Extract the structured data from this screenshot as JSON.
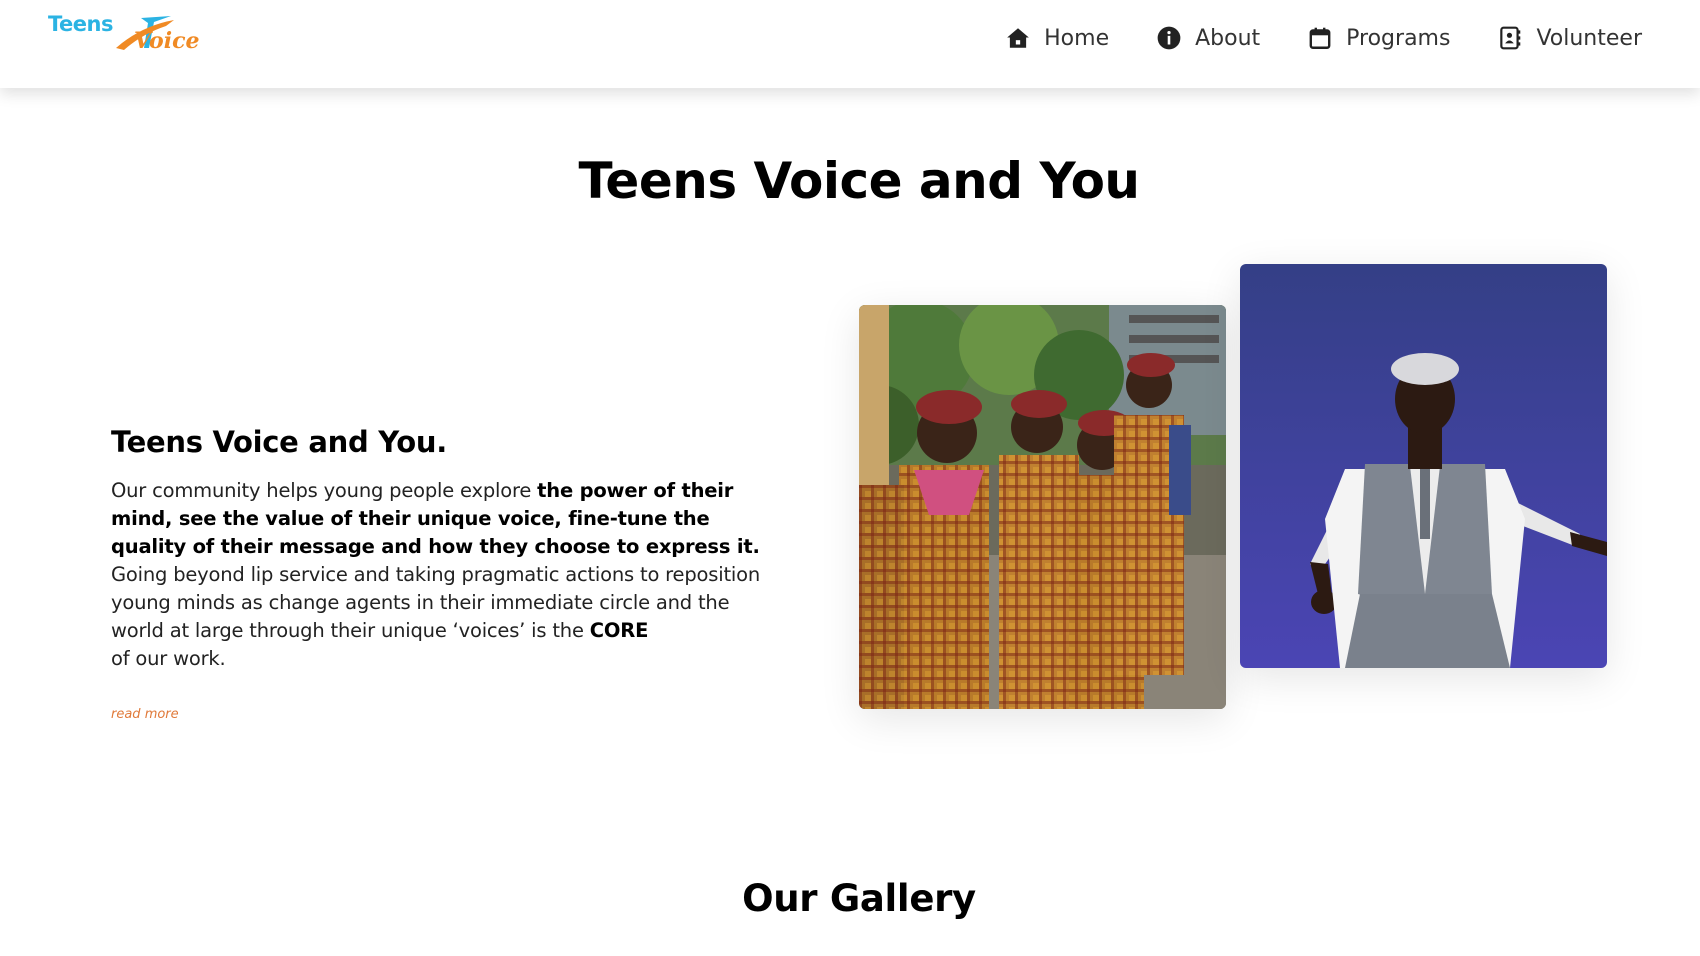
{
  "brand": {
    "logo_text_top": "Teens",
    "logo_text_bottom": "Voice",
    "colors": {
      "blue": "#2bb3e3",
      "orange": "#f08a24"
    }
  },
  "nav": {
    "items": [
      {
        "label": "Home",
        "icon": "home-icon"
      },
      {
        "label": "About",
        "icon": "info-icon"
      },
      {
        "label": "Programs",
        "icon": "calendar-icon"
      },
      {
        "label": "Volunteer",
        "icon": "contact-book-icon"
      }
    ]
  },
  "hero": {
    "title": "Teens Voice and You"
  },
  "intro": {
    "heading": "Teens Voice and You.",
    "text_1": "Our community helps young people explore ",
    "bold_1": "the power of their mind, see the value of their unique voice, fine-tune the quality of their message and how they choose to express it.",
    "text_2": " Going beyond lip service and taking pragmatic actions to reposition young minds as change agents in their immediate circle and the world at large through their unique ‘voices’ is the ",
    "bold_2": "CORE",
    "text_3": "of our work.",
    "read_more": "read more",
    "read_more_color": "#e07a3a"
  },
  "gallery": {
    "title": "Our Gallery"
  }
}
